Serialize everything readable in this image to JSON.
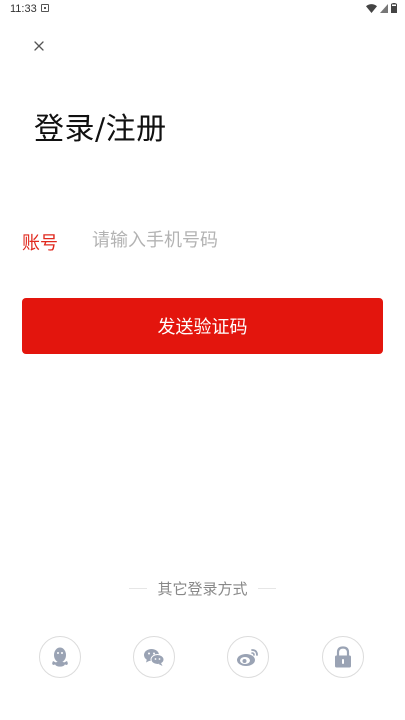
{
  "status_bar": {
    "time": "11:33",
    "icons": [
      "notification-icon",
      "wifi-icon",
      "signal-icon",
      "battery-icon"
    ]
  },
  "header": {
    "close_icon": "close-icon",
    "title": "登录/注册"
  },
  "form": {
    "account_label": "账号",
    "account_placeholder": "请输入手机号码",
    "account_value": "",
    "send_button_label": "发送验证码"
  },
  "other_login": {
    "label": "其它登录方式",
    "methods": [
      {
        "icon": "qq-icon"
      },
      {
        "icon": "wechat-icon"
      },
      {
        "icon": "weibo-icon"
      },
      {
        "icon": "lock-icon"
      }
    ]
  },
  "colors": {
    "accent": "#e3150d",
    "label_red": "#e0281d",
    "placeholder": "#b3b3b3",
    "icon_gray": "#9aa3b4"
  }
}
